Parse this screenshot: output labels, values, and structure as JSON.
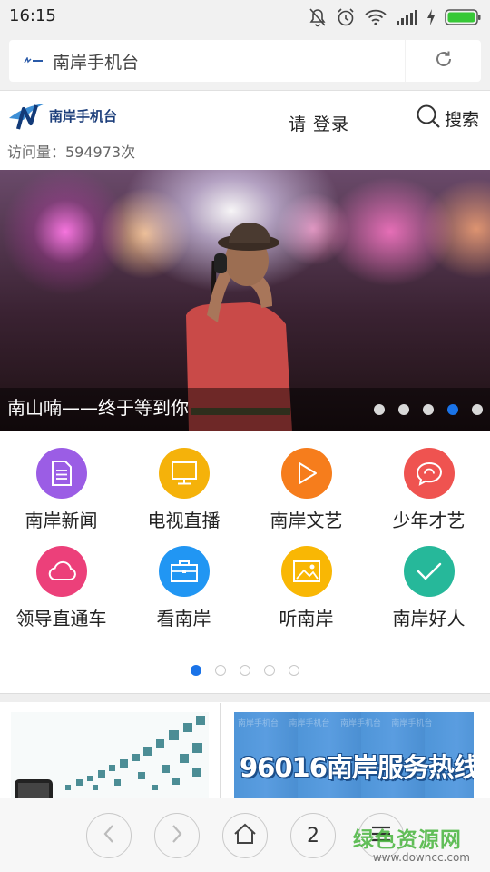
{
  "status_bar": {
    "time": "16:15",
    "icons": [
      "mute-icon",
      "alarm-icon",
      "wifi-icon",
      "signal-icon",
      "charging-icon",
      "battery-icon"
    ]
  },
  "address_bar": {
    "url_text": "南岸手机台",
    "reload_icon": "reload-icon"
  },
  "header": {
    "logo_text": "南岸手机台",
    "login_label": "请 登录",
    "search_label": "搜索",
    "visits_text": "访问量：594973次"
  },
  "banner": {
    "caption": "南山喃——终于等到你",
    "slide_count": 5,
    "active_slide": 4
  },
  "grid": {
    "items": [
      {
        "label": "南岸新闻",
        "icon": "document-icon",
        "color": "#9b5de5"
      },
      {
        "label": "电视直播",
        "icon": "monitor-icon",
        "color": "#f5b20a"
      },
      {
        "label": "南岸文艺",
        "icon": "play-icon",
        "color": "#f67d1c"
      },
      {
        "label": "少年才艺",
        "icon": "chat-bubble-icon",
        "color": "#ef5350"
      },
      {
        "label": "领导直通车",
        "icon": "cloud-icon",
        "color": "#ec407a"
      },
      {
        "label": "看南岸",
        "icon": "briefcase-icon",
        "color": "#2196f3"
      },
      {
        "label": "听南岸",
        "icon": "image-icon",
        "color": "#f9b704"
      },
      {
        "label": "南岸好人",
        "icon": "check-icon",
        "color": "#26b89a"
      }
    ],
    "page_count": 5,
    "active_page": 1
  },
  "promo": {
    "right_title": "96016南岸服务热线",
    "right_watermark": "南岸手机台"
  },
  "toolbar": {
    "tab_count": "2",
    "icons": [
      "back-icon",
      "forward-icon",
      "home-icon",
      "tabs-icon",
      "menu-icon"
    ]
  },
  "watermark": {
    "title": "绿色资源网",
    "url": "www.downcc.com"
  }
}
